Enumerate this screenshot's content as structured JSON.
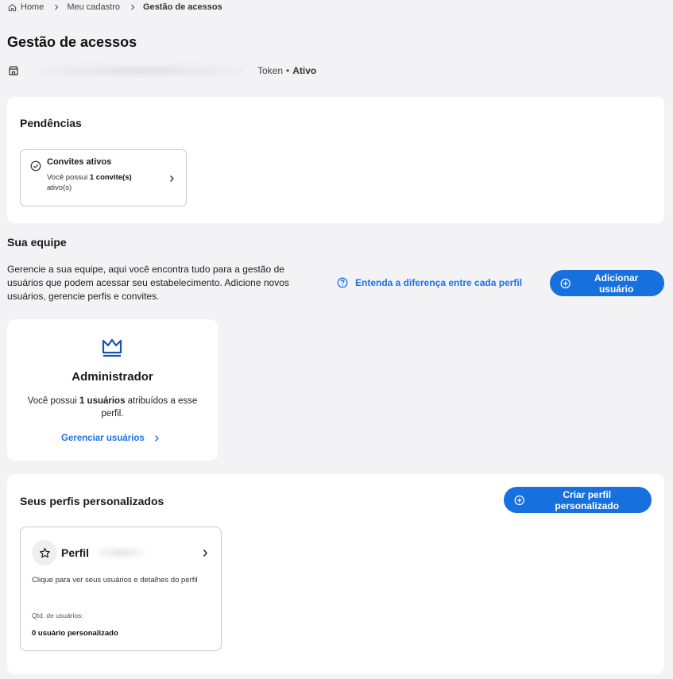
{
  "breadcrumb": {
    "items": [
      "Home",
      "Meu cadastro",
      "Gestão de acessos"
    ]
  },
  "page": {
    "title": "Gestão de acessos"
  },
  "store": {
    "token_label": "Token",
    "bullet": "•",
    "status": "Ativo"
  },
  "pendencias": {
    "title": "Pendências",
    "invites": {
      "title": "Convites ativos",
      "desc_prefix": "Você possui ",
      "desc_bold": "1 convite(s)",
      "desc_suffix": " ativo(s)"
    }
  },
  "team": {
    "title": "Sua equipe",
    "description": "Gerencie a sua equipe, aqui você encontra tudo para a gestão de usuários que podem acessar seu estabelecimento. Adicione novos usuários, gerencie perfis e convites.",
    "diff_link": "Entenda a diferença entre cada perfil",
    "add_button": "Adicionar usuário"
  },
  "admin_card": {
    "title": "Administrador",
    "desc_prefix": "Você possui ",
    "desc_bold": "1 usuários",
    "desc_suffix": " atribuídos a esse perfil.",
    "manage_link": "Gerenciar usuários"
  },
  "custom_profiles": {
    "title": "Seus perfis personalizados",
    "create_button": "Criar perfil personalizado",
    "profile": {
      "title": "Perfil",
      "description": "Clique para ver seus usuários e detalhes do perfil",
      "qtd_label": "Qtd. de usuários:",
      "qtd_value": "0 usuário personalizado"
    }
  },
  "colors": {
    "accent": "#1671de",
    "link": "#1a73e8",
    "background": "#f3f3f5",
    "card": "#ffffff"
  },
  "icons": {
    "home": "home-icon",
    "store": "store-icon",
    "check": "check-circle-icon",
    "help": "help-circle-icon",
    "plus": "plus-circle-icon",
    "crown": "crown-icon",
    "star": "star-icon",
    "chevron": "chevron-right-icon"
  }
}
